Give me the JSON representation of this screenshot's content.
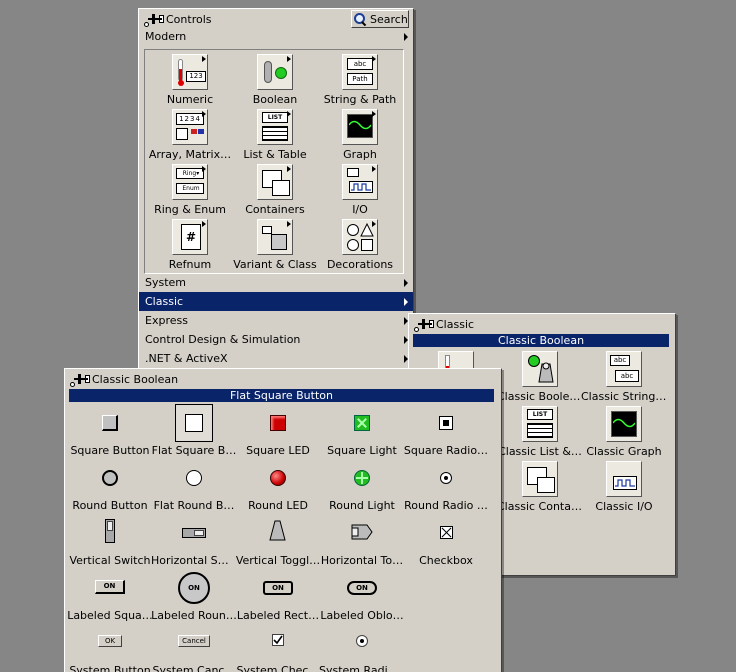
{
  "controls_palette": {
    "title": "Controls",
    "search_label": "Search",
    "modern_label": "Modern",
    "modern_items": [
      {
        "label": "Numeric",
        "icon": "numeric-icon"
      },
      {
        "label": "Boolean",
        "icon": "boolean-icon"
      },
      {
        "label": "String & Path",
        "icon": "string-path-icon"
      },
      {
        "label": "Array, Matrix…",
        "icon": "array-matrix-icon"
      },
      {
        "label": "List & Table",
        "icon": "list-table-icon"
      },
      {
        "label": "Graph",
        "icon": "graph-icon"
      },
      {
        "label": "Ring & Enum",
        "icon": "ring-enum-icon"
      },
      {
        "label": "Containers",
        "icon": "containers-icon"
      },
      {
        "label": "I/O",
        "icon": "io-icon"
      },
      {
        "label": "Refnum",
        "icon": "refnum-icon"
      },
      {
        "label": "Variant & Class",
        "icon": "variant-class-icon"
      },
      {
        "label": "Decorations",
        "icon": "decorations-icon"
      }
    ],
    "categories": [
      {
        "label": "System"
      },
      {
        "label": "Classic",
        "selected": true
      },
      {
        "label": "Express"
      },
      {
        "label": "Control Design & Simulation"
      },
      {
        "label": ".NET & ActiveX"
      }
    ],
    "selected_color": "#0a246a"
  },
  "classic_palette": {
    "title": "Classic",
    "highlight_label": "Classic Boolean",
    "items": [
      {
        "label": "Classic Boolean",
        "icon": "classic-boolean-icon"
      },
      {
        "label": "Classic String …",
        "icon": "classic-string-icon"
      },
      {
        "label": "Classic List &…",
        "icon": "classic-list-icon"
      },
      {
        "label": "Classic Graph",
        "icon": "classic-graph-icon"
      },
      {
        "label": "Classic Contai…",
        "icon": "classic-containers-icon"
      },
      {
        "label": "Classic I/O",
        "icon": "classic-io-icon"
      }
    ]
  },
  "boolean_palette": {
    "title": "Classic Boolean",
    "highlight_label": "Flat Square Button",
    "items": [
      {
        "label": "Square Button",
        "icon": "square-button-icon"
      },
      {
        "label": "Flat Square B…",
        "icon": "flat-square-button-icon"
      },
      {
        "label": "Square LED",
        "icon": "square-led-icon"
      },
      {
        "label": "Square Light",
        "icon": "square-light-icon"
      },
      {
        "label": "Square Radio…",
        "icon": "square-radio-icon"
      },
      {
        "label": "Round Button",
        "icon": "round-button-icon"
      },
      {
        "label": "Flat Round B…",
        "icon": "flat-round-button-icon"
      },
      {
        "label": "Round LED",
        "icon": "round-led-icon"
      },
      {
        "label": "Round Light",
        "icon": "round-light-icon"
      },
      {
        "label": "Round Radio …",
        "icon": "round-radio-icon"
      },
      {
        "label": "Vertical Switch",
        "icon": "vertical-switch-icon"
      },
      {
        "label": "Horizontal Sw…",
        "icon": "horizontal-switch-icon"
      },
      {
        "label": "Vertical Toggl…",
        "icon": "vertical-toggle-icon"
      },
      {
        "label": "Horizontal To…",
        "icon": "horizontal-toggle-icon"
      },
      {
        "label": "Checkbox",
        "icon": "checkbox-icon"
      },
      {
        "label": "Labeled Squa…",
        "icon": "labeled-square-icon"
      },
      {
        "label": "Labeled Roun…",
        "icon": "labeled-round-icon"
      },
      {
        "label": "Labeled Rect…",
        "icon": "labeled-rect-icon"
      },
      {
        "label": "Labeled Oblo…",
        "icon": "labeled-oblong-icon"
      },
      {
        "label": "System Button",
        "icon": "system-button-icon"
      },
      {
        "label": "System Canc…",
        "icon": "system-cancel-icon"
      },
      {
        "label": "System Chec…",
        "icon": "system-checkbox-icon"
      },
      {
        "label": "System Radio…",
        "icon": "system-radio-icon"
      }
    ],
    "glyph_text": {
      "on": "ON",
      "ok": "OK",
      "cancel": "Cancel"
    }
  },
  "colors": {
    "panel": "#d4d0c8",
    "desktop": "#868686",
    "highlight": "#0a246a",
    "led_red": "#cc0000",
    "light_green": "#22bb22"
  }
}
